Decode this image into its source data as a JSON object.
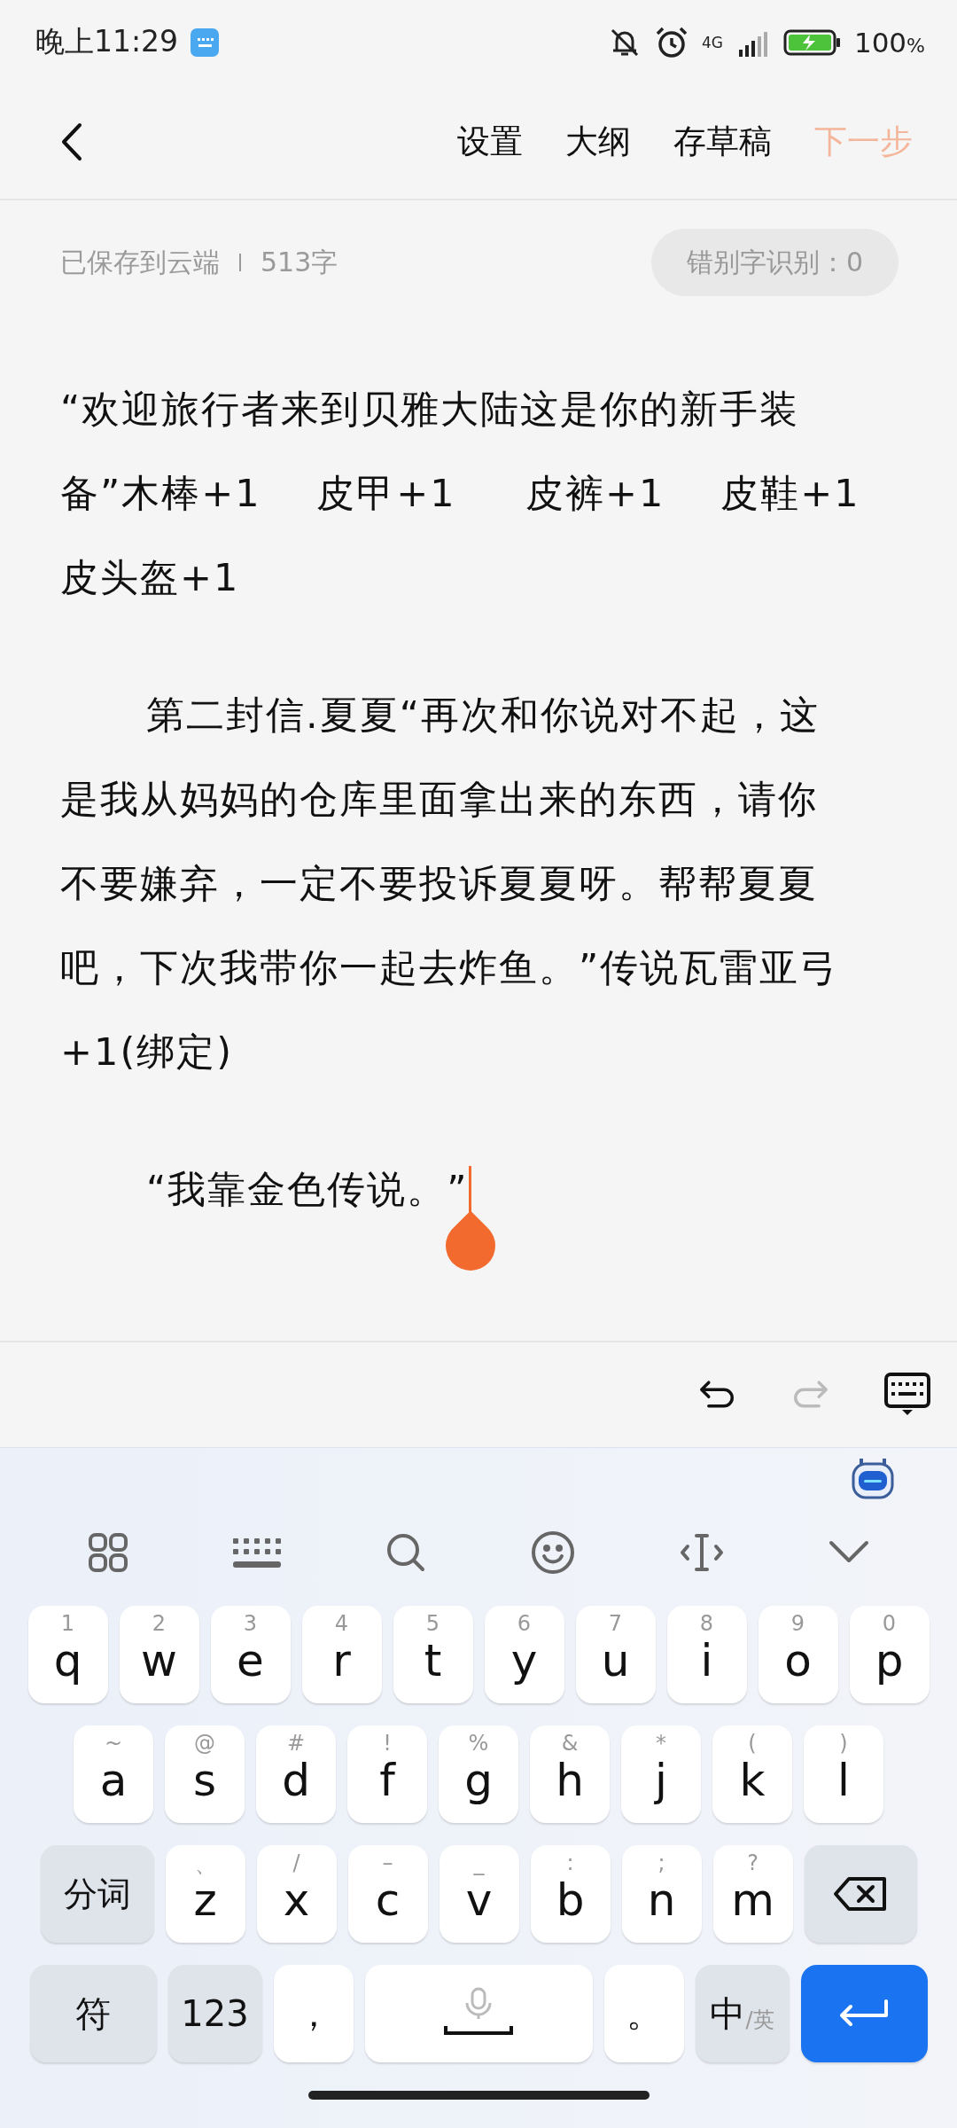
{
  "status_bar": {
    "time": "晚上11:29",
    "network": "4G",
    "battery": "100",
    "battery_unit": "%"
  },
  "header": {
    "nav": [
      {
        "label": "设置",
        "kind": "plain",
        "disabled": false
      },
      {
        "label": "大纲",
        "kind": "plain",
        "disabled": false
      },
      {
        "label": "存草稿",
        "kind": "plain",
        "disabled": false
      },
      {
        "label": "下一步",
        "kind": "primary",
        "disabled": true
      }
    ]
  },
  "meta": {
    "saved": "已保存到云端",
    "word_count": "513字",
    "typo_check": "错别字识别：0"
  },
  "paragraphs": [
    {
      "indent": false,
      "caret": false,
      "lines": [
        "“欢迎旅行者来到贝雅大陆这是你的新手装",
        "备”木棒+1    皮甲+1     皮裤+1    皮鞋+1",
        "皮头盔+1"
      ]
    },
    {
      "indent": true,
      "caret": false,
      "lines": [
        "第二封信.夏夏“再次和你说对不起，这",
        "是我从妈妈的仓库里面拿出来的东西，请你",
        "不要嫌弃，一定不要投诉夏夏呀。帮帮夏夏",
        "吧，下次我带你一起去炸鱼。”传说瓦雷亚弓",
        "+1(绑定)"
      ]
    },
    {
      "indent": true,
      "caret": true,
      "lines": [
        "“我靠金色传说。”"
      ]
    }
  ],
  "edit_toolbar": [
    {
      "kind": "undo",
      "disabled": false
    },
    {
      "kind": "redo",
      "disabled": true
    },
    {
      "kind": "hide_keyboard",
      "disabled": false
    }
  ],
  "keyboard": {
    "row_1": [
      {
        "kind": "letter",
        "char": "q",
        "hint": "1"
      },
      {
        "kind": "letter",
        "char": "w",
        "hint": "2"
      },
      {
        "kind": "letter",
        "char": "e",
        "hint": "3"
      },
      {
        "kind": "letter",
        "char": "r",
        "hint": "4"
      },
      {
        "kind": "letter",
        "char": "t",
        "hint": "5"
      },
      {
        "kind": "letter",
        "char": "y",
        "hint": "6"
      },
      {
        "kind": "letter",
        "char": "u",
        "hint": "7"
      },
      {
        "kind": "letter",
        "char": "i",
        "hint": "8"
      },
      {
        "kind": "letter",
        "char": "o",
        "hint": "9"
      },
      {
        "kind": "letter",
        "char": "p",
        "hint": "0"
      }
    ],
    "row_2": [
      {
        "kind": "letter",
        "char": "a",
        "hint": "~"
      },
      {
        "kind": "letter",
        "char": "s",
        "hint": "@"
      },
      {
        "kind": "letter",
        "char": "d",
        "hint": "#"
      },
      {
        "kind": "letter",
        "char": "f",
        "hint": "!"
      },
      {
        "kind": "letter",
        "char": "g",
        "hint": "%"
      },
      {
        "kind": "letter",
        "char": "h",
        "hint": "&"
      },
      {
        "kind": "letter",
        "char": "j",
        "hint": "*"
      },
      {
        "kind": "letter",
        "char": "k",
        "hint": "("
      },
      {
        "kind": "letter",
        "char": "l",
        "hint": ")"
      }
    ],
    "row_3": [
      {
        "kind": "function",
        "char": "分词"
      },
      {
        "kind": "letter",
        "char": "z",
        "hint": "、"
      },
      {
        "kind": "letter",
        "char": "x",
        "hint": "/"
      },
      {
        "kind": "letter",
        "char": "c",
        "hint": "–"
      },
      {
        "kind": "letter",
        "char": "v",
        "hint": "_"
      },
      {
        "kind": "letter",
        "char": "b",
        "hint": ":"
      },
      {
        "kind": "letter",
        "char": "n",
        "hint": ";"
      },
      {
        "kind": "letter",
        "char": "m",
        "hint": "?"
      },
      {
        "kind": "backspace"
      }
    ],
    "bottom_row": [
      {
        "kind": "symbols",
        "char": "符"
      },
      {
        "kind": "numbers",
        "char": "123"
      },
      {
        "kind": "punct",
        "char": "，"
      },
      {
        "kind": "space"
      },
      {
        "kind": "punct",
        "char": "。"
      },
      {
        "kind": "lang",
        "char": "中",
        "hint": "/英"
      },
      {
        "kind": "enter"
      }
    ]
  }
}
